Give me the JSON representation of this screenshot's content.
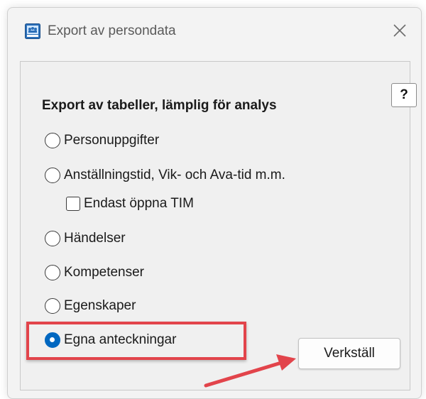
{
  "window": {
    "title": "Export av persondata"
  },
  "dialog": {
    "help_label": "?",
    "heading": "Export av tabeller, lämplig för analys",
    "options": [
      {
        "label": "Personuppgifter",
        "checked": false
      },
      {
        "label": "Anställningstid, Vik- och Ava-tid m.m.",
        "checked": false
      },
      {
        "label": "Händelser",
        "checked": false
      },
      {
        "label": "Kompetenser",
        "checked": false
      },
      {
        "label": "Egenskaper",
        "checked": false
      },
      {
        "label": "Egna anteckningar",
        "checked": true
      }
    ],
    "sub_checkbox": {
      "label": "Endast öppna TIM",
      "checked": false
    },
    "apply_label": "Verkställ"
  },
  "annotation": {
    "highlight_color": "#e2444b",
    "arrow_color": "#e2444b"
  },
  "colors": {
    "accent": "#0067c0"
  },
  "icons": {
    "app": "people-chart-icon",
    "close": "close-icon"
  }
}
